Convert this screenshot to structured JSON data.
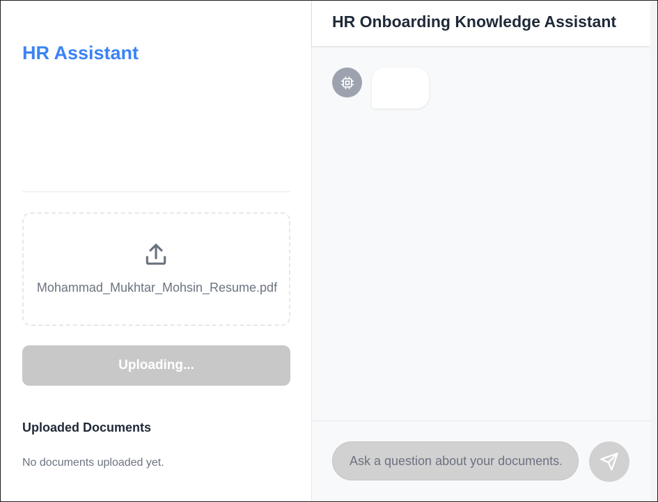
{
  "sidebar": {
    "brand": "HR Assistant",
    "dropzone": {
      "icon": "upload-icon",
      "file_name": "Mohammad_Mukhtar_Mohsin_Resume.pdf"
    },
    "upload_button_label": "Uploading...",
    "documents": {
      "title": "Uploaded Documents",
      "empty_text": "No documents uploaded yet."
    }
  },
  "main": {
    "header_title": "HR Onboarding Knowledge Assistant",
    "messages": [
      {
        "role": "assistant",
        "avatar_icon": "cpu-icon",
        "text": ""
      }
    ],
    "input": {
      "placeholder": "Ask a question about your documents...",
      "value": ""
    },
    "send_icon": "send-icon"
  },
  "colors": {
    "brand": "#3b82f6",
    "disabled": "#c8c8c8",
    "avatar": "#9ca3af",
    "text_dark": "#1f2937",
    "text_muted": "#6b7280"
  }
}
